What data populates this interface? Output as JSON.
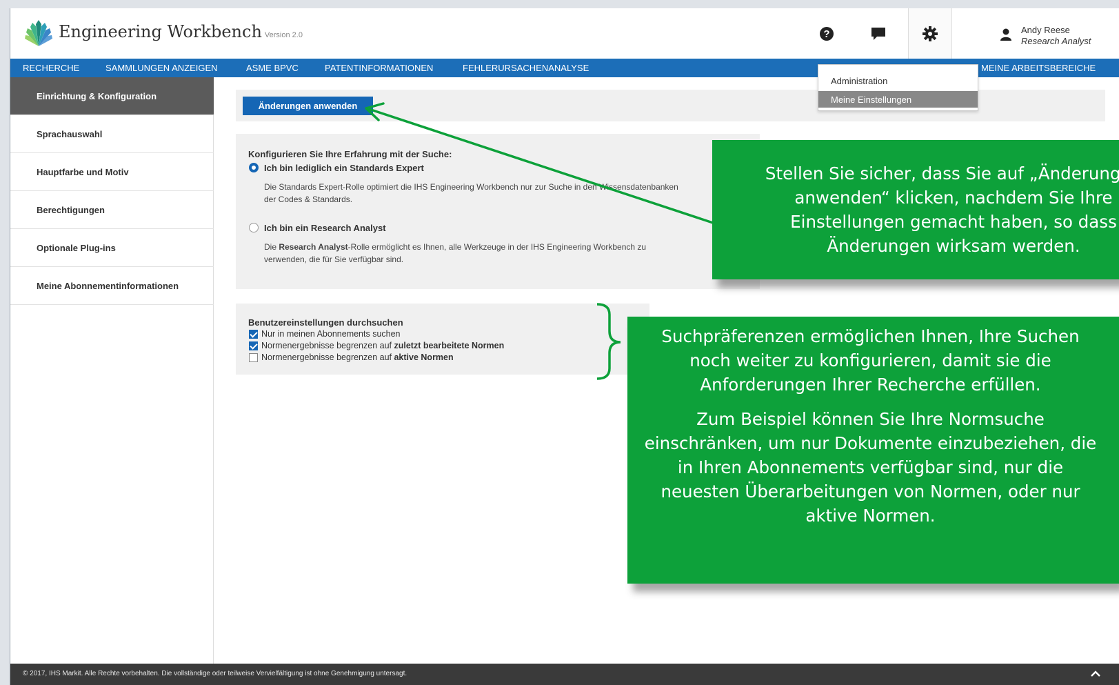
{
  "header": {
    "brand": "Engineering Workbench",
    "version": "Version 2.0",
    "icons": [
      "help-icon",
      "chat-icon",
      "gear-icon",
      "person-icon"
    ],
    "user_name": "Andy Reese",
    "user_role": "Research Analyst"
  },
  "nav": {
    "items": [
      "RECHERCHE",
      "SAMMLUNGEN ANZEIGEN",
      "ASME BPVC",
      "PATENTINFORMATIONEN",
      "FEHLERURSACHENANALYSE"
    ],
    "right_item": "MEINE ARBEITSBEREICHE"
  },
  "settings_menu": {
    "items": [
      "Administration",
      "Meine Einstellungen"
    ],
    "selected": "Meine Einstellungen"
  },
  "sidebar": {
    "items": [
      "Einrichtung & Konfiguration",
      "Sprachauswahl",
      "Hauptfarbe und Motiv",
      "Berechtigungen",
      "Optionale Plug-ins",
      "Meine Abonnementinformationen"
    ],
    "active": "Einrichtung & Konfiguration"
  },
  "main": {
    "apply_button": "Änderungen anwenden",
    "experience": {
      "title": "Konfigurieren Sie Ihre Erfahrung mit der Suche:",
      "options": [
        {
          "label": "Ich bin lediglich ein Standards Expert",
          "selected": true,
          "desc1": "Die Standards Expert-Rolle optimiert die IHS Engineering Workbench nur zur Suche in den Wissensdatenbanken",
          "desc2": "der Codes & Standards."
        },
        {
          "label": "Ich bin ein Research Analyst",
          "selected": false,
          "desc_bold": "Research Analyst",
          "desc_pre": "Die ",
          "desc_post": "-Rolle ermöglicht es Ihnen, alle Werkzeuge in der IHS Engineering Workbench zu",
          "desc2": "verwenden, die für Sie verfügbar sind."
        }
      ]
    },
    "search_prefs": {
      "title": "Benutzereinstellungen durchsuchen",
      "options": [
        {
          "text": "Nur in meinen Abonnements suchen",
          "bold": "",
          "checked": true
        },
        {
          "text": "Normenergebnisse begrenzen auf ",
          "bold": "zuletzt bearbeitete Normen",
          "checked": true
        },
        {
          "text": "Normenergebnisse begrenzen auf ",
          "bold": "aktive Normen",
          "checked": false
        }
      ]
    }
  },
  "footer": {
    "text": "© 2017, IHS Markit. Alle Rechte vorbehalten. Die vollständige oder teilweise Vervielfältigung ist ohne Genehmigung untersagt."
  },
  "callouts": {
    "apply": "Stellen Sie sicher, dass Sie auf „Änderungen\nanwenden“ klicken, nachdem Sie Ihre\nEinstellungen gemacht haben, so dass\nÄnderungen wirksam werden.",
    "prefs_p1": "Suchpräferenzen ermöglichen Ihnen, Ihre Suchen noch weiter zu konfigurieren, damit sie die Anforderungen Ihrer Recherche erfüllen.",
    "prefs_p2": "Zum Beispiel können Sie Ihre Normsuche einschränken, um nur Dokumente einzubeziehen, die in Ihren Abonnements verfügbar sind, nur die neuesten Überarbeitungen von Normen, oder nur aktive Normen."
  },
  "colors": {
    "nav_blue": "#1c6eb8",
    "button_blue": "#1566b5",
    "callout_green": "#0da13a",
    "sidebar_active": "#5b5b5b",
    "footer": "#3a3a3a"
  }
}
